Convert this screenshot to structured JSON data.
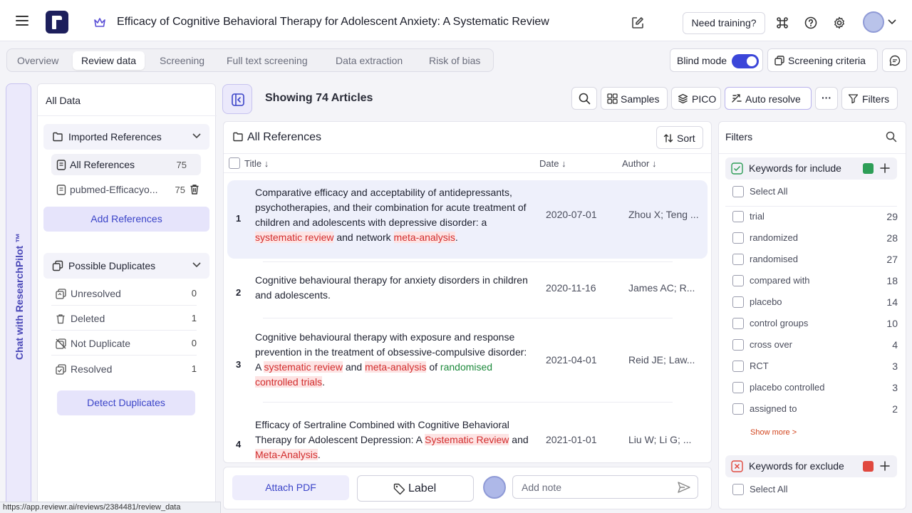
{
  "header": {
    "title": "Efficacy of Cognitive Behavioral Therapy for Adolescent Anxiety: A Systematic Review",
    "need_training": "Need training?"
  },
  "tabs": [
    {
      "label": "Overview"
    },
    {
      "label": "Review data"
    },
    {
      "label": "Screening"
    },
    {
      "label": "Full text screening"
    },
    {
      "label": "Data extraction"
    },
    {
      "label": "Risk of bias"
    }
  ],
  "blind_mode": {
    "label": "Blind mode",
    "on": true
  },
  "screening_criteria": "Screening criteria",
  "chat_tab": "Chat with ResearchPilot ™",
  "left_panel": {
    "title": "All Data",
    "imported": {
      "heading": "Imported References",
      "items": [
        {
          "label": "All References",
          "count": "75"
        },
        {
          "label": "pubmed-Efficacyo...",
          "count": "75"
        }
      ],
      "add_button": "Add References"
    },
    "duplicates": {
      "heading": "Possible Duplicates",
      "items": [
        {
          "label": "Unresolved",
          "count": "0"
        },
        {
          "label": "Deleted",
          "count": "1"
        },
        {
          "label": "Not Duplicate",
          "count": "0"
        },
        {
          "label": "Resolved",
          "count": "1"
        }
      ],
      "detect_button": "Detect Duplicates"
    }
  },
  "toolbar": {
    "showing": "Showing 74 Articles",
    "samples": "Samples",
    "pico": "PICO",
    "auto_resolve": "Auto resolve",
    "more": "···",
    "filters": "Filters"
  },
  "articles": {
    "heading": "All References",
    "sort": "Sort",
    "columns": {
      "title": "Title",
      "date": "Date",
      "author": "Author"
    },
    "rows": [
      {
        "num": "1",
        "date": "2020-07-01",
        "author": "Zhou X; Teng ...",
        "t": [
          "Comparative efficacy and acceptability of antidepressants, psychotherapies, and their combination for acute treatment of children and adolescents with depressive disorder: a ",
          "systematic review",
          " and network ",
          "meta-analysis",
          "."
        ]
      },
      {
        "num": "2",
        "date": "2020-11-16",
        "author": "James AC; R...",
        "t": [
          "Cognitive behavioural therapy for anxiety disorders in children and adolescents."
        ]
      },
      {
        "num": "3",
        "date": "2021-04-01",
        "author": "Reid JE; Law...",
        "t": [
          "Cognitive behavioural therapy with exposure and response prevention in the treatment of obsessive-compulsive disorder: A ",
          "systematic review",
          " and ",
          "meta-analysis",
          " of ",
          "randomised",
          " ",
          "controlled trials",
          "."
        ]
      },
      {
        "num": "4",
        "date": "2021-01-01",
        "author": "Liu W; Li G; ...",
        "t": [
          "Efficacy of Sertraline Combined with Cognitive Behavioral Therapy for Adolescent Depression: A ",
          "Systematic Review",
          " and ",
          "Meta-Analysis",
          "."
        ]
      }
    ]
  },
  "actions": {
    "attach_pdf": "Attach PDF",
    "label": "Label",
    "note_placeholder": "Add note"
  },
  "filters": {
    "title": "Filters",
    "include_heading": "Keywords for include",
    "select_all": "Select All",
    "keywords": [
      {
        "label": "trial",
        "count": "29"
      },
      {
        "label": "randomized",
        "count": "28"
      },
      {
        "label": "randomised",
        "count": "27"
      },
      {
        "label": "compared with",
        "count": "18"
      },
      {
        "label": "placebo",
        "count": "14"
      },
      {
        "label": "control groups",
        "count": "10"
      },
      {
        "label": "cross over",
        "count": "4"
      },
      {
        "label": "RCT",
        "count": "3"
      },
      {
        "label": "placebo controlled",
        "count": "3"
      },
      {
        "label": "assigned to",
        "count": "2"
      }
    ],
    "show_more": "Show more >",
    "exclude_heading": "Keywords for exclude",
    "select_all_exclude": "Select All"
  },
  "status_url": "https://app.reviewr.ai/reviews/2384481/review_data",
  "colors": {
    "accent": "#3b46d9",
    "include": "#2e9e57",
    "exclude": "#e0483e",
    "highlight": "#d22d2d"
  }
}
